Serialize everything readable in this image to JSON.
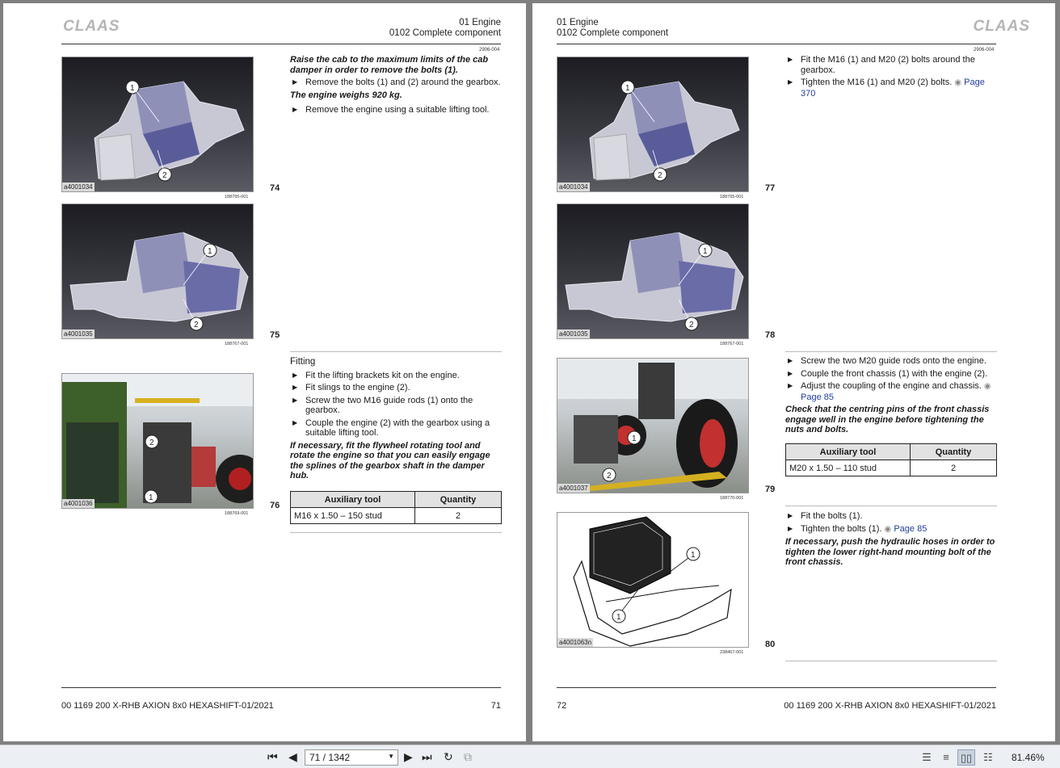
{
  "brand": "CLAAS",
  "left_page": {
    "header_line1": "01 Engine",
    "header_line2": "0102 Complete component",
    "section_code": "2906-004",
    "figures": [
      {
        "id": "a4001034",
        "code": "188765-001",
        "num": "74"
      },
      {
        "id": "a4001035",
        "code": "188767-001",
        "num": "75"
      },
      {
        "id": "a4001036",
        "code": "188769-001",
        "num": "76"
      }
    ],
    "block1": {
      "note1": "Raise the cab to the maximum limits of the cab damper in order to remove the bolts (1).",
      "step1": "Remove the bolts (1) and (2) around the gearbox.",
      "note2": "The engine weighs 920 kg.",
      "step2": "Remove the engine using a suitable lifting tool."
    },
    "block2": {
      "heading": "Fitting",
      "steps": [
        "Fit the lifting brackets kit on the engine.",
        "Fit slings to the engine (2).",
        "Screw the two M16 guide rods (1) onto the gearbox.",
        "Couple the engine (2) with the gearbox using a suitable lifting tool."
      ],
      "note": "If necessary, fit the flywheel rotating tool and rotate the engine so that you can easily engage the splines of the gearbox shaft in the damper hub."
    },
    "table": {
      "col1": "Auxiliary tool",
      "col2": "Quantity",
      "row_tool": "M16 x 1.50 – 150 stud",
      "row_qty": "2"
    },
    "footer_doc": "00 1169 200 X-RHB AXION 8x0 HEXASHIFT-01/2021",
    "footer_page": "71"
  },
  "right_page": {
    "header_line1": "01 Engine",
    "header_line2": "0102 Complete component",
    "section_code": "2906-004",
    "figures": [
      {
        "id": "a4001034",
        "code": "188765-001",
        "num": "77"
      },
      {
        "id": "a4001035",
        "code": "188767-001",
        "num": "78"
      },
      {
        "id": "a4001037",
        "code": "188770-001",
        "num": "79"
      },
      {
        "id": "a4001063n",
        "code": "238467-001",
        "num": "80"
      }
    ],
    "block1": {
      "step1": "Fit the M16 (1) and M20 (2) bolts around the gearbox.",
      "step2_text": "Tighten the M16 (1) and M20 (2) bolts.",
      "step2_link": "Page 370"
    },
    "block2": {
      "step1": "Screw the two M20 guide rods onto the engine.",
      "step2": "Couple the front chassis (1) with the engine (2).",
      "step3_text": "Adjust the coupling of the engine and chassis.",
      "step3_link": "Page 85",
      "note": "Check that the centring pins of the front chassis engage well in the engine before tightening the nuts and bolts."
    },
    "table": {
      "col1": "Auxiliary tool",
      "col2": "Quantity",
      "row_tool": "M20 x 1.50 – 110 stud",
      "row_qty": "2"
    },
    "block3": {
      "step1": "Fit the bolts (1).",
      "step2_text": "Tighten the bolts (1).",
      "step2_link": "Page 85",
      "note": "If necessary, push the hydraulic hoses in order to tighten the lower right-hand mounting bolt of the front chassis."
    },
    "footer_page": "72",
    "footer_doc": "00 1169 200 X-RHB AXION 8x0 HEXASHIFT-01/2021"
  },
  "toolbar": {
    "page_indicator": "71 / 1342",
    "zoom": "81.46%",
    "icons": [
      "first-page-icon",
      "previous-page-icon",
      "next-page-icon",
      "last-page-icon",
      "rotate-icon",
      "fit-icon"
    ]
  }
}
